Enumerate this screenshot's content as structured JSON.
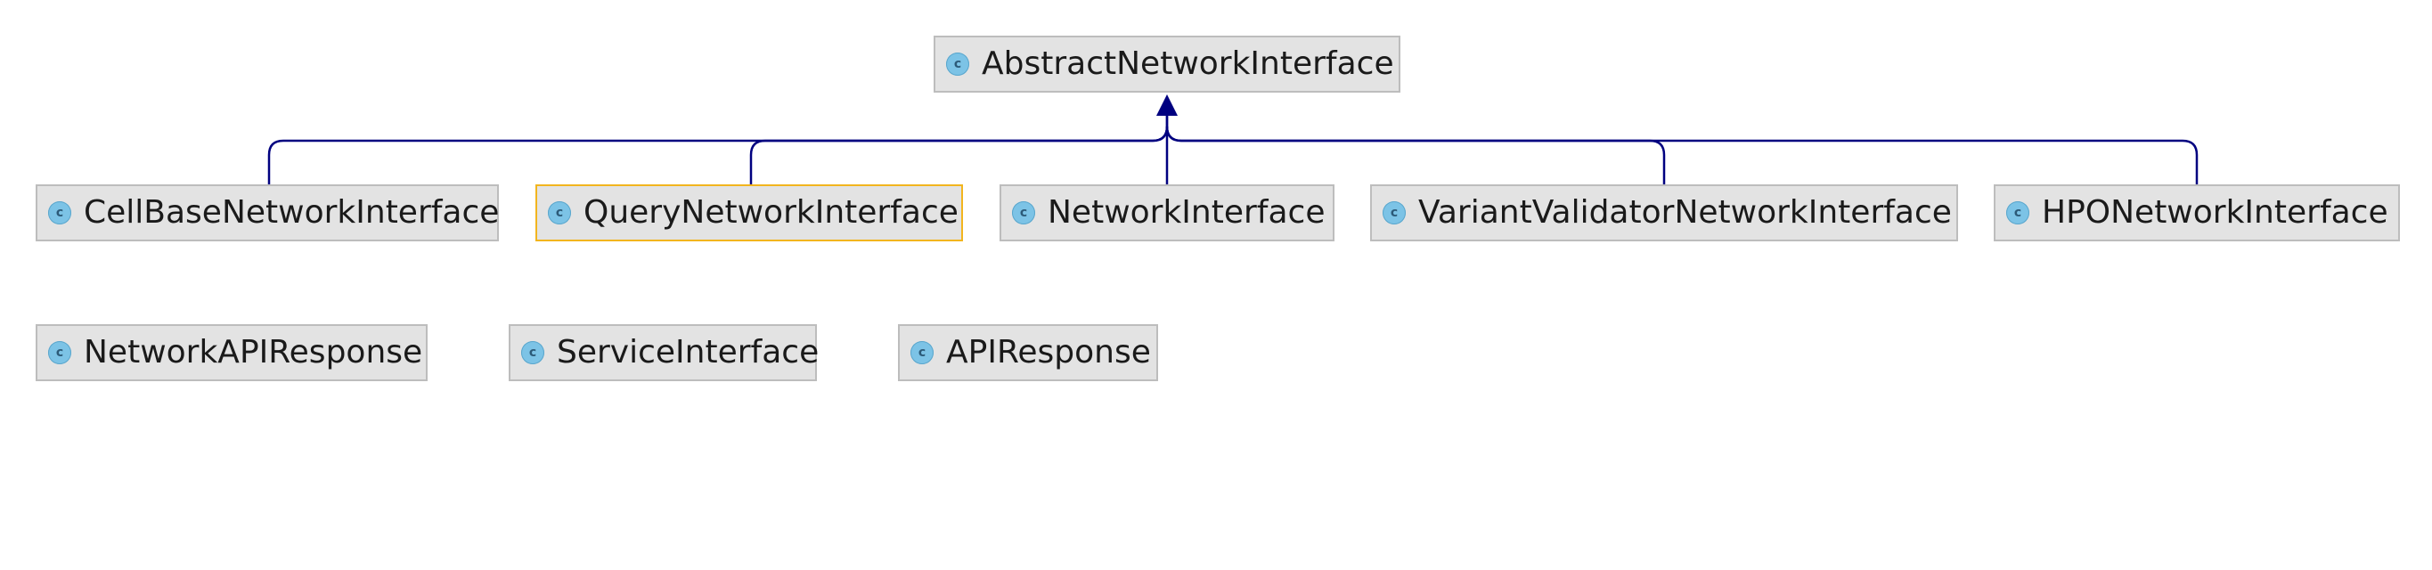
{
  "diagram": {
    "nodes": [
      {
        "id": "abstract",
        "label": "AbstractNetworkInterface",
        "icon": "class-icon",
        "icon_glyph": "c"
      },
      {
        "id": "cellbase",
        "label": "CellBaseNetworkInterface",
        "icon": "class-icon",
        "icon_glyph": "c"
      },
      {
        "id": "query",
        "label": "QueryNetworkInterface",
        "icon": "class-icon",
        "icon_glyph": "c",
        "selected": true
      },
      {
        "id": "network",
        "label": "NetworkInterface",
        "icon": "class-icon",
        "icon_glyph": "c"
      },
      {
        "id": "variant",
        "label": "VariantValidatorNetworkInterface",
        "icon": "class-icon",
        "icon_glyph": "c"
      },
      {
        "id": "hpo",
        "label": "HPONetworkInterface",
        "icon": "class-icon",
        "icon_glyph": "c"
      },
      {
        "id": "networkapi",
        "label": "NetworkAPIResponse",
        "icon": "class-icon",
        "icon_glyph": "c"
      },
      {
        "id": "service",
        "label": "ServiceInterface",
        "icon": "class-icon",
        "icon_glyph": "c"
      },
      {
        "id": "apiresponse",
        "label": "APIResponse",
        "icon": "class-icon",
        "icon_glyph": "c"
      }
    ],
    "edges": [
      {
        "from": "cellbase",
        "to": "abstract",
        "type": "extends"
      },
      {
        "from": "query",
        "to": "abstract",
        "type": "extends"
      },
      {
        "from": "network",
        "to": "abstract",
        "type": "extends"
      },
      {
        "from": "variant",
        "to": "abstract",
        "type": "extends"
      },
      {
        "from": "hpo",
        "to": "abstract",
        "type": "extends"
      }
    ],
    "colors": {
      "edge": "#000080",
      "node_fill": "#e3e3e3",
      "node_border": "#bdbdbd",
      "selected_border": "#f2b51e",
      "icon_fill": "#7cc3e6"
    }
  }
}
